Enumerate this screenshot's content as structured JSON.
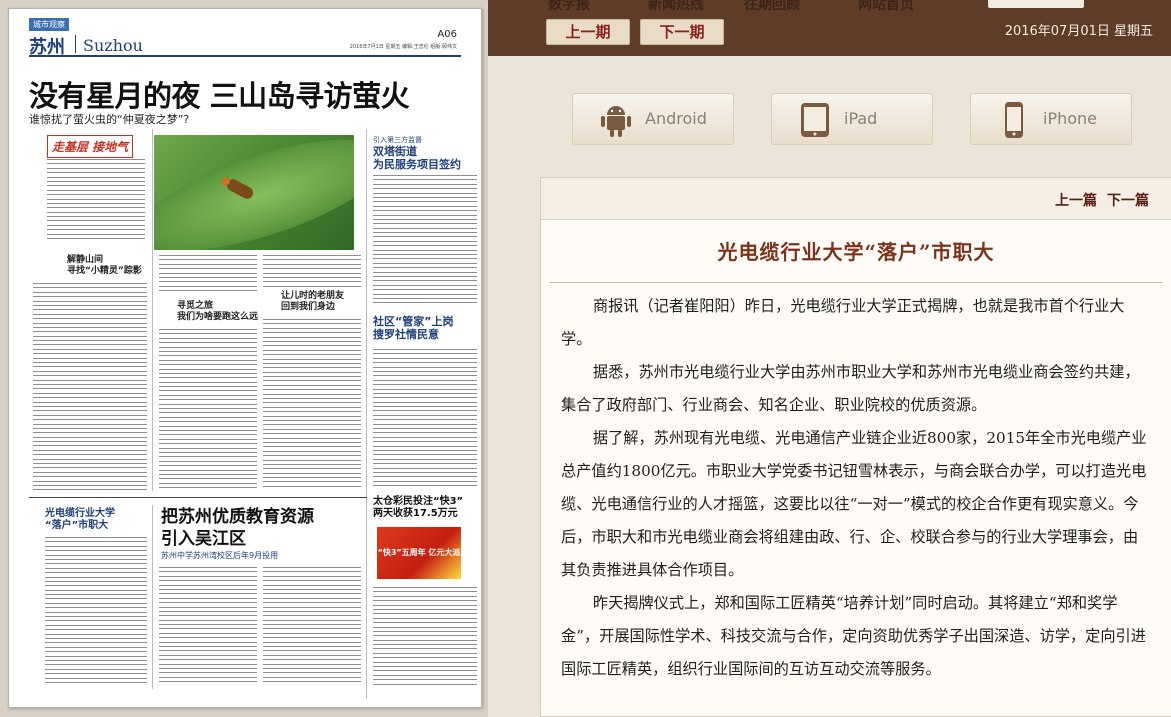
{
  "newspaper": {
    "masthead_tag": "城市观察",
    "city": "苏州",
    "city_en": "Suzhou",
    "page_no": "A06",
    "page_meta": "2016年7月1日 星期五  编辑:王志伦  组版:顾伟文",
    "headline": "没有星月的夜 三山岛寻访萤火",
    "subheadline": "谁惊扰了萤火虫的“仲夏夜之梦”?",
    "kicker": "走基层 接地气",
    "col1_head1": "解静山间",
    "col1_head2": "寻找“小精灵”踪影",
    "sidebar_label": "引入第三方监督",
    "sidebar_head": "双塔街道\n为民服务项目签约",
    "mid_head1": "寻觅之旅",
    "mid_head2": "我们为啥要跑这么远",
    "mid_head3": "让儿时的老朋友",
    "mid_head4": "回到我们身边",
    "sidebar_head2": "社区“管家”上岗\n搜罗社情民意",
    "story2_head": "把苏州优质教育资源\n引入吴江区",
    "story2_sub": "苏州中学苏州湾校区后年9月投用",
    "story3_head": "光电缆行业大学\n“落户”市职大",
    "promo_head": "太仓彩民投注“快3”\n两天收获17.5万元",
    "promo_text": "“快3”五周年 亿元大派奖"
  },
  "toolbar": {
    "nav_ghosts": [
      "数字报",
      "新闻热线",
      "往期回顾",
      "网站首页"
    ],
    "prev_issue": "上一期",
    "next_issue": "下一期",
    "date": "2016年07月01日 星期五"
  },
  "apps": [
    {
      "label": "Android",
      "icon": "android-icon"
    },
    {
      "label": "iPad",
      "icon": "ipad-icon"
    },
    {
      "label": "iPhone",
      "icon": "iphone-icon"
    }
  ],
  "article": {
    "prev_article": "上一篇",
    "next_article": "下一篇",
    "title": "光电缆行业大学“落户”市职大",
    "paragraphs": [
      "商报讯（记者崔阳阳）昨日，光电缆行业大学正式揭牌，也就是我市首个行业大学。",
      "据悉，苏州市光电缆行业大学由苏州市职业大学和苏州市光电缆业商会签约共建，集合了政府部门、行业商会、知名企业、职业院校的优质资源。",
      "据了解，苏州现有光电缆、光电通信产业链企业近800家，2015年全市光电缆产业总产值约1800亿元。市职业大学党委书记钮雪林表示，与商会联合办学，可以打造光电缆、光电通信行业的人才摇篮，这要比以往“一对一”模式的校企合作更有现实意义。今后，市职大和市光电缆业商会将组建由政、行、企、校联合参与的行业大学理事会，由其负责推进具体合作项目。",
      "昨天揭牌仪式上，郑和国际工匠精英“培养计划”同时启动。其将建立“郑和奖学金”，开展国际性学术、科技交流与合作，定向资助优秀学子出国深造、访学，定向引进国际工匠精英，组织行业国际间的互访互动交流等服务。"
    ]
  }
}
